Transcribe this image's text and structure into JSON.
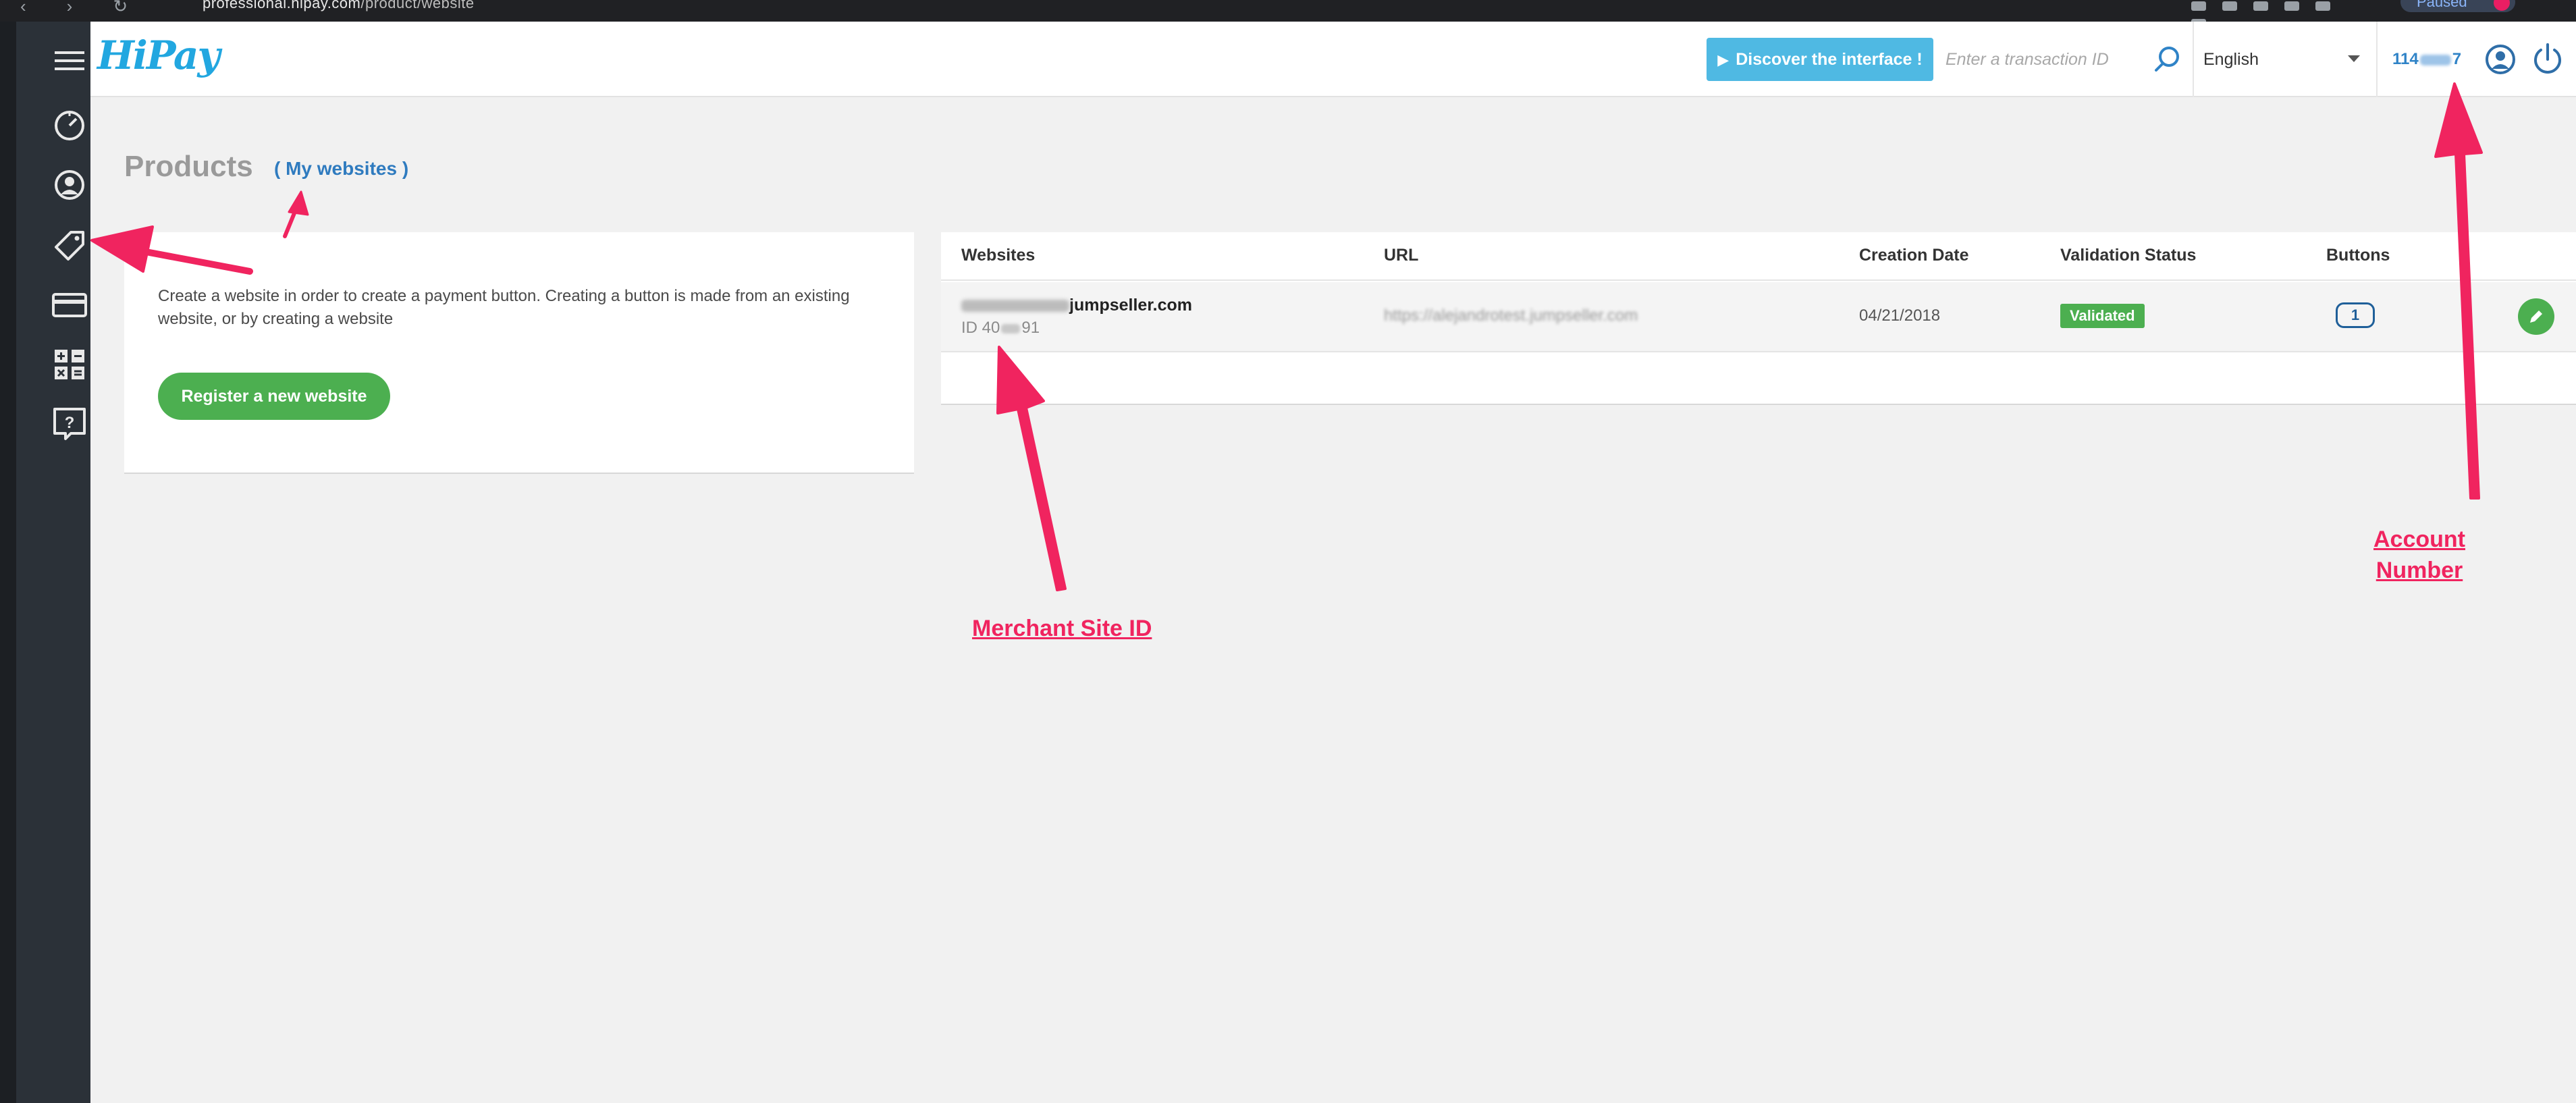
{
  "browser": {
    "url_host": "professional.hipay.com",
    "url_path": "/product/website",
    "paused_label": "Paused"
  },
  "sidebar": {
    "items": [
      {
        "icon": "hamburger-menu-icon"
      },
      {
        "icon": "dashboard-icon"
      },
      {
        "icon": "user-icon"
      },
      {
        "icon": "tag-icon"
      },
      {
        "icon": "credit-card-icon"
      },
      {
        "icon": "calculator-icon"
      },
      {
        "icon": "help-icon"
      }
    ]
  },
  "header": {
    "logo": "HiPay",
    "discover_label": "Discover the interface !",
    "transaction_placeholder": "Enter a transaction ID",
    "language": "English",
    "account_prefix": "114",
    "account_suffix": "7"
  },
  "page": {
    "title": "Products",
    "subtitle_link": "( My websites )"
  },
  "intro_card": {
    "text": "Create a website in order to create a payment button. Creating a button is made from an existing website, or by creating a website",
    "register_label": "Register a new website"
  },
  "websites_table": {
    "columns": [
      "Websites",
      "URL",
      "Creation Date",
      "Validation Status",
      "Buttons"
    ],
    "rows": [
      {
        "website_visible": "jumpseller.com",
        "id_prefix": "ID 40",
        "id_suffix": "91",
        "url": "https://alejandrotest.jumpseller.com",
        "creation_date": "04/21/2018",
        "status": "Validated",
        "buttons": "1"
      }
    ]
  },
  "annotations": {
    "merchant_site_id": "Merchant Site ID",
    "account_number": "Account Number"
  },
  "colors": {
    "sidebar": "#2b3138",
    "brand_blue": "#22a7e0",
    "discover_blue": "#4fb9e3",
    "link_blue": "#2f7bbf",
    "success_green": "#4caf50",
    "annotation_pink": "#f0245f"
  }
}
